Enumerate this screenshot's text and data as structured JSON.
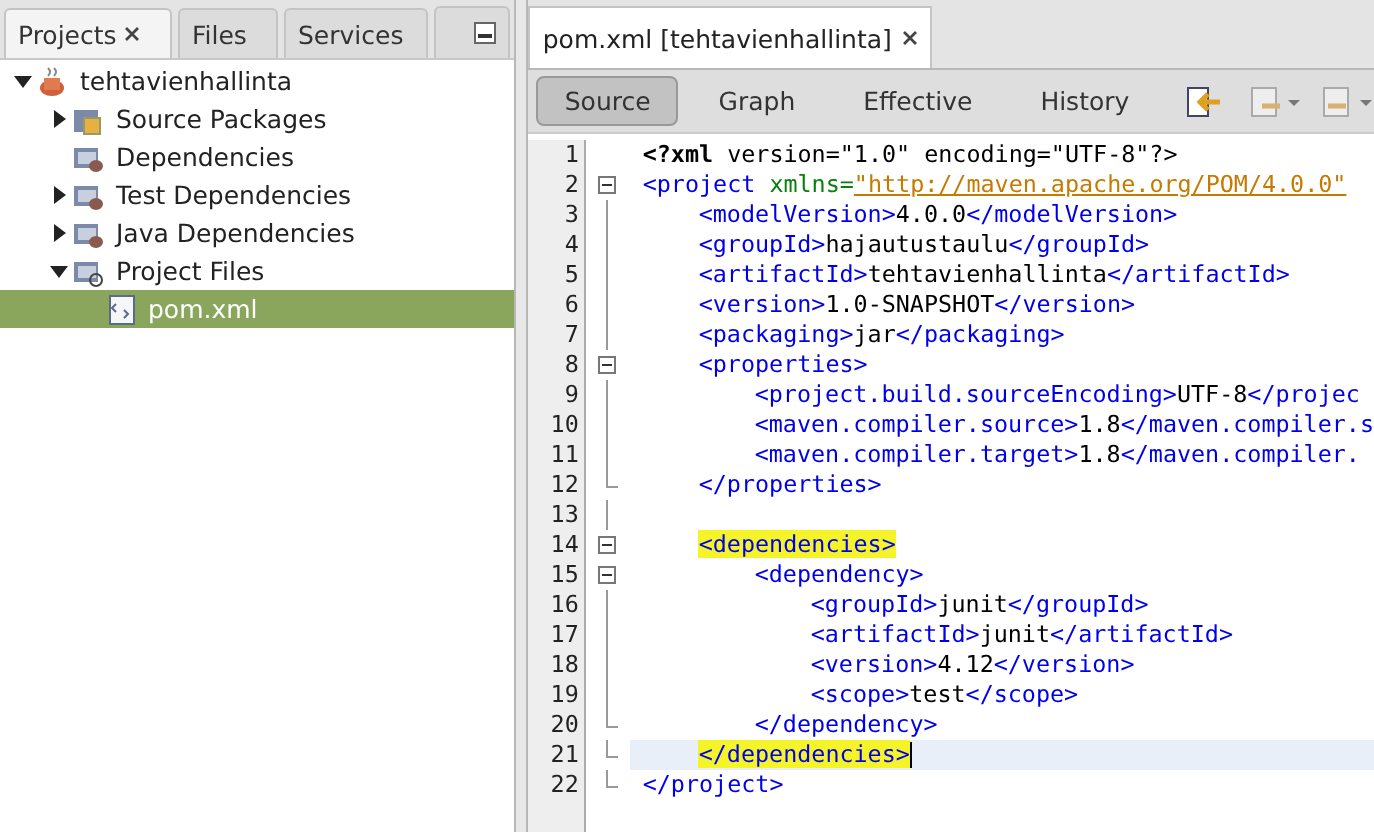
{
  "left_panel": {
    "tabs": [
      {
        "label": "Projects",
        "selected": true,
        "closable": true
      },
      {
        "label": "Files",
        "selected": false,
        "closable": false
      },
      {
        "label": "Services",
        "selected": false,
        "closable": false
      }
    ],
    "tree": [
      {
        "label": "tehtavienhallinta",
        "kind": "project",
        "expanded": true,
        "selected": false,
        "children": [
          {
            "label": "Source Packages",
            "kind": "packages",
            "expanded": false,
            "selected": false
          },
          {
            "label": "Dependencies",
            "kind": "library",
            "selected": false
          },
          {
            "label": "Test Dependencies",
            "kind": "library",
            "expanded": false,
            "selected": false
          },
          {
            "label": "Java Dependencies",
            "kind": "library",
            "expanded": false,
            "selected": false
          },
          {
            "label": "Project Files",
            "kind": "settings",
            "expanded": true,
            "selected": false,
            "children": [
              {
                "label": "pom.xml",
                "kind": "file",
                "selected": true
              }
            ]
          }
        ]
      }
    ]
  },
  "editor": {
    "tab": {
      "label": "pom.xml [tehtavienhallinta]",
      "selected": true
    },
    "views": [
      {
        "label": "Source",
        "selected": true
      },
      {
        "label": "Graph",
        "selected": false
      },
      {
        "label": "Effective",
        "selected": false
      },
      {
        "label": "History",
        "selected": false
      }
    ],
    "lines": [
      {
        "number": "1",
        "current": false,
        "tokens": [
          {
            "kind": "decl",
            "text": "<?xml"
          },
          {
            "kind": "text",
            "text": " version=\"1.0\" encoding=\"UTF-8\"?>"
          }
        ]
      },
      {
        "number": "2",
        "current": false,
        "tokens": [
          {
            "kind": "tag",
            "text": "<project"
          },
          {
            "kind": "attr",
            "text": " xmlns="
          },
          {
            "kind": "link",
            "text": "\"http://maven.apache.org/POM/4.0.0\""
          }
        ],
        "children": [
          {
            "number": "3",
            "current": false,
            "tokens": [
              {
                "kind": "tag",
                "text": "<modelVersion>"
              },
              {
                "kind": "text",
                "text": "4.0.0"
              },
              {
                "kind": "tag",
                "text": "</modelVersion>"
              }
            ]
          },
          {
            "number": "4",
            "current": false,
            "tokens": [
              {
                "kind": "tag",
                "text": "<groupId>"
              },
              {
                "kind": "text",
                "text": "hajautustaulu"
              },
              {
                "kind": "tag",
                "text": "</groupId>"
              }
            ]
          },
          {
            "number": "5",
            "current": false,
            "tokens": [
              {
                "kind": "tag",
                "text": "<artifactId>"
              },
              {
                "kind": "text",
                "text": "tehtavienhallinta"
              },
              {
                "kind": "tag",
                "text": "</artifactId>"
              }
            ]
          },
          {
            "number": "6",
            "current": false,
            "tokens": [
              {
                "kind": "tag",
                "text": "<version>"
              },
              {
                "kind": "text",
                "text": "1.0-SNAPSHOT"
              },
              {
                "kind": "tag",
                "text": "</version>"
              }
            ]
          },
          {
            "number": "7",
            "current": false,
            "tokens": [
              {
                "kind": "tag",
                "text": "<packaging>"
              },
              {
                "kind": "text",
                "text": "jar"
              },
              {
                "kind": "tag",
                "text": "</packaging>"
              }
            ]
          },
          {
            "number": "8",
            "current": false,
            "tokens": [
              {
                "kind": "tag",
                "text": "<properties>"
              }
            ],
            "children": [
              {
                "number": "9",
                "current": false,
                "tokens": [
                  {
                    "kind": "tag",
                    "text": "<project.build.sourceEncoding>"
                  },
                  {
                    "kind": "text",
                    "text": "UTF-8"
                  },
                  {
                    "kind": "tag",
                    "text": "</projec"
                  }
                ]
              },
              {
                "number": "10",
                "current": false,
                "tokens": [
                  {
                    "kind": "tag",
                    "text": "<maven.compiler.source>"
                  },
                  {
                    "kind": "text",
                    "text": "1.8"
                  },
                  {
                    "kind": "tag",
                    "text": "</maven.compiler.s"
                  }
                ]
              },
              {
                "number": "11",
                "current": false,
                "tokens": [
                  {
                    "kind": "tag",
                    "text": "<maven.compiler.target>"
                  },
                  {
                    "kind": "text",
                    "text": "1.8"
                  },
                  {
                    "kind": "tag",
                    "text": "</maven.compiler."
                  }
                ]
              }
            ],
            "closing": {
              "number": "12",
              "current": false,
              "tokens": [
                {
                  "kind": "tag",
                  "text": "</properties>"
                }
              ]
            }
          },
          {
            "number": "13",
            "current": false
          },
          {
            "number": "14",
            "current": false,
            "tokens": [
              {
                "kind": "match",
                "text": "<dependencies>"
              }
            ],
            "children": [
              {
                "number": "15",
                "current": false,
                "tokens": [
                  {
                    "kind": "tag",
                    "text": "<dependency>"
                  }
                ],
                "children": [
                  {
                    "number": "16",
                    "current": false,
                    "tokens": [
                      {
                        "kind": "tag",
                        "text": "<groupId>"
                      },
                      {
                        "kind": "text",
                        "text": "junit"
                      },
                      {
                        "kind": "tag",
                        "text": "</groupId>"
                      }
                    ]
                  },
                  {
                    "number": "17",
                    "current": false,
                    "tokens": [
                      {
                        "kind": "tag",
                        "text": "<artifactId>"
                      },
                      {
                        "kind": "text",
                        "text": "junit"
                      },
                      {
                        "kind": "tag",
                        "text": "</artifactId>"
                      }
                    ]
                  },
                  {
                    "number": "18",
                    "current": false,
                    "tokens": [
                      {
                        "kind": "tag",
                        "text": "<version>"
                      },
                      {
                        "kind": "text",
                        "text": "4.12"
                      },
                      {
                        "kind": "tag",
                        "text": "</version>"
                      }
                    ]
                  },
                  {
                    "number": "19",
                    "current": false,
                    "tokens": [
                      {
                        "kind": "tag",
                        "text": "<scope>"
                      },
                      {
                        "kind": "text",
                        "text": "test"
                      },
                      {
                        "kind": "tag",
                        "text": "</scope>"
                      }
                    ]
                  }
                ],
                "closing": {
                  "number": "20",
                  "current": false,
                  "tokens": [
                    {
                      "kind": "tag",
                      "text": "</dependency>"
                    }
                  ]
                }
              }
            ],
            "closing": {
              "number": "21",
              "current": true,
              "tokens": [
                {
                  "kind": "match",
                  "text": "</dependencies>"
                }
              ]
            }
          }
        ],
        "closing": {
          "number": "22",
          "current": false,
          "tokens": [
            {
              "kind": "tag",
              "text": "</project>"
            }
          ]
        }
      }
    ]
  }
}
